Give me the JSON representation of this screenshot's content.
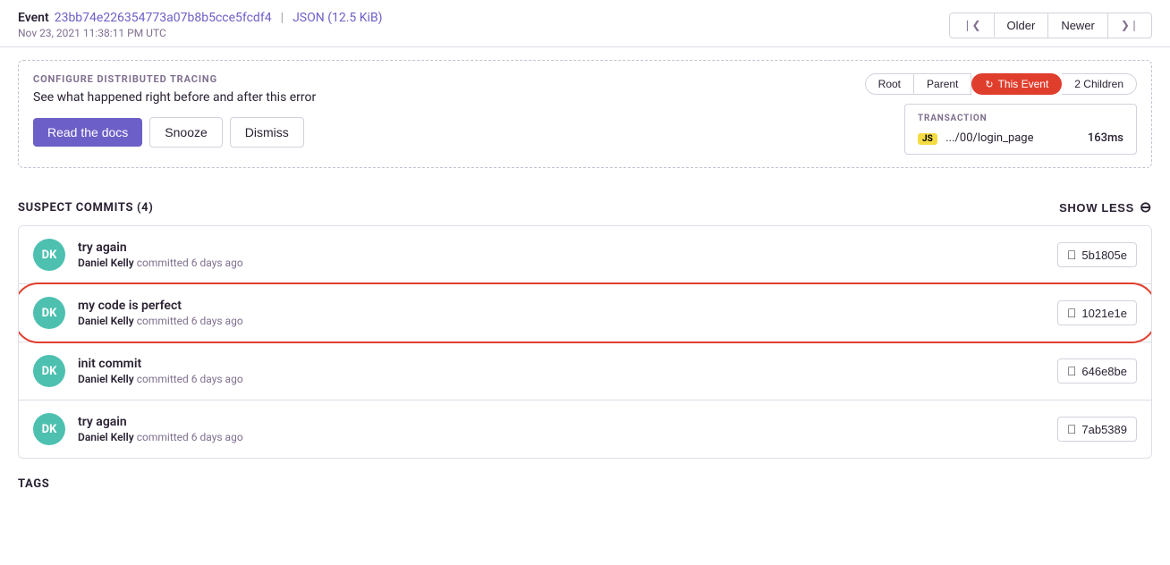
{
  "header": {
    "event_label": "Event",
    "event_id": "23bb74e226354773a07b8b5cce5fcdf4",
    "pipe": "|",
    "json_label": "JSON (12.5 KiB)",
    "date": "Nov 23, 2021 11:38:11 PM UTC",
    "nav": {
      "older": "Older",
      "newer": "Newer"
    }
  },
  "tracing_banner": {
    "title": "CONFIGURE DISTRIBUTED TRACING",
    "description": "See what happened right before and after this error",
    "read_docs_btn": "Read the docs",
    "snooze_btn": "Snooze",
    "dismiss_btn": "Dismiss",
    "tabs": {
      "root": "Root",
      "parent": "Parent",
      "this_event": "This Event",
      "children": "2 Children"
    },
    "transaction": {
      "label": "TRANSACTION",
      "name": ".../00/login_page",
      "time": "163ms",
      "badge": "JS"
    }
  },
  "suspect_commits": {
    "title": "SUSPECT COMMITS (4)",
    "show_less": "SHOW LESS",
    "commits": [
      {
        "initials": "DK",
        "message": "try again",
        "author": "Daniel Kelly",
        "time": "committed 6 days ago",
        "hash": "5b1805e",
        "highlighted": false
      },
      {
        "initials": "DK",
        "message": "my code is perfect",
        "author": "Daniel Kelly",
        "time": "committed 6 days ago",
        "hash": "1021e1e",
        "highlighted": true
      },
      {
        "initials": "DK",
        "message": "init commit",
        "author": "Daniel Kelly",
        "time": "committed 6 days ago",
        "hash": "646e8be",
        "highlighted": false
      },
      {
        "initials": "DK",
        "message": "try again",
        "author": "Daniel Kelly",
        "time": "committed 6 days ago",
        "hash": "7ab5389",
        "highlighted": false
      }
    ]
  },
  "tags": {
    "title": "TAGS"
  }
}
